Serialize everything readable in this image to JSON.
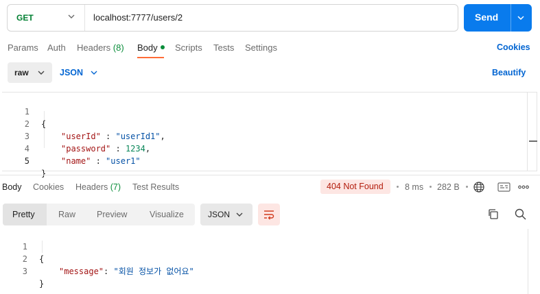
{
  "request": {
    "method": "GET",
    "url": "localhost:7777/users/2",
    "send_label": "Send"
  },
  "request_tabs": {
    "params": "Params",
    "auth": "Auth",
    "headers": "Headers",
    "headers_count": "(8)",
    "body": "Body",
    "scripts": "Scripts",
    "tests": "Tests",
    "settings": "Settings",
    "cookies": "Cookies"
  },
  "body_options": {
    "mode": "raw",
    "language": "JSON",
    "beautify": "Beautify"
  },
  "request_body": {
    "line_numbers": [
      "1",
      "2",
      "3",
      "4",
      "5"
    ],
    "open_brace": "{",
    "close_brace": "}",
    "lines": [
      {
        "key": "\"userId\"",
        "sep": " : ",
        "value": "\"userId1\"",
        "trail": ","
      },
      {
        "key": "\"password\"",
        "sep": " : ",
        "value": "1234",
        "trail": ","
      },
      {
        "key": "\"name\"",
        "sep": " : ",
        "value": "\"user1\"",
        "trail": ""
      }
    ]
  },
  "response_tabs": {
    "body": "Body",
    "cookies": "Cookies",
    "headers": "Headers",
    "headers_count": "(7)",
    "test_results": "Test Results"
  },
  "response_meta": {
    "status": "404 Not Found",
    "time": "8 ms",
    "size": "282 B"
  },
  "response_view": {
    "pretty": "Pretty",
    "raw": "Raw",
    "preview": "Preview",
    "visualize": "Visualize",
    "format": "JSON"
  },
  "response_body": {
    "line_numbers": [
      "1",
      "2",
      "3"
    ],
    "open_brace": "{",
    "close_brace": "}",
    "key": "\"message\"",
    "sep": ": ",
    "value": "\"회원 정보가 없어요\""
  },
  "colors": {
    "accent": "#097bed",
    "tab_indicator": "#ff6c37",
    "method_get": "#007f31",
    "link": "#0265d2",
    "status_error_bg": "#fde6e3",
    "status_error_text": "#b31d0d"
  },
  "icons": {
    "method_dropdown": "chevron-down-icon",
    "send_dropdown": "chevron-down-icon",
    "globe": "globe-icon",
    "save_response": "save-icon",
    "more": "more-horizontal-icon",
    "wrap": "wrap-lines-icon",
    "copy": "copy-icon",
    "search": "search-icon"
  }
}
